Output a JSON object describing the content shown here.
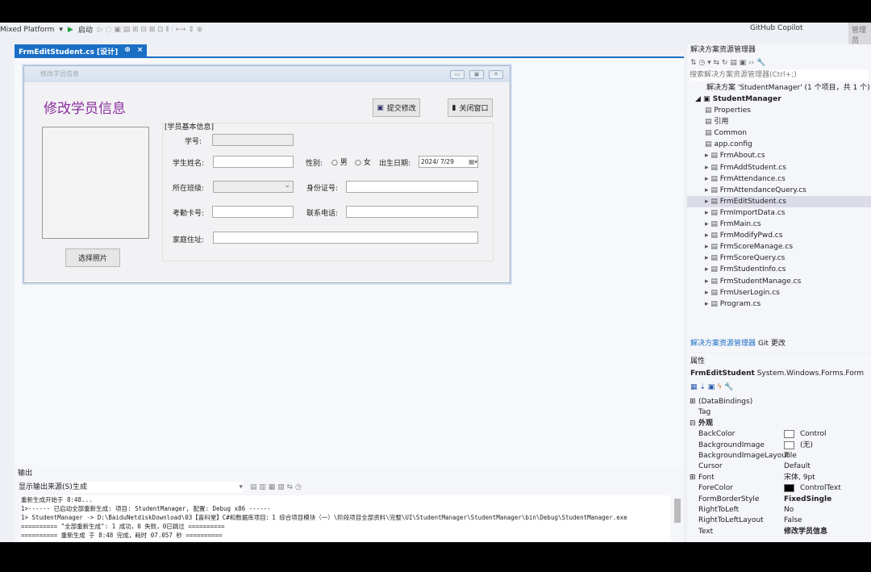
{
  "toolbar": {
    "platform": "Mixed Platform",
    "start": "启动",
    "copilot": "GitHub Copilot",
    "manage": "管理员"
  },
  "doc_tab": {
    "label": "FrmEditStudent.cs [设计]",
    "pin": "⊕",
    "close": "×"
  },
  "form": {
    "window_title": "修改学员信息",
    "heading": "修改学员信息",
    "submit": "提交修改",
    "close_window": "关闭窗口",
    "choose_photo": "选择照片",
    "group_title": "[学员基本信息]",
    "fields": {
      "student_id": "学号:",
      "name": "学生姓名:",
      "gender": "性别:",
      "male": "男",
      "female": "女",
      "birth": "出生日期:",
      "birth_value": "2024/ 7/29",
      "class": "所在班级:",
      "id_card": "身份证号:",
      "card_no": "考勤卡号:",
      "phone": "联系电话:",
      "address": "家庭住址:"
    }
  },
  "solution_explorer": {
    "title": "解决方案资源管理器",
    "search_placeholder": "搜索解决方案资源管理器(Ctrl+;)",
    "solution": "解决方案 'StudentManager' (1 个项目，共 1 个)",
    "project": "StudentManager",
    "items": [
      "Properties",
      "引用",
      "Common",
      "app.config",
      "FrmAbout.cs",
      "FrmAddStudent.cs",
      "FrmAttendance.cs",
      "FrmAttendanceQuery.cs",
      "FrmEditStudent.cs",
      "FrmImportData.cs",
      "FrmMain.cs",
      "FrmModifyPwd.cs",
      "FrmScoreManage.cs",
      "FrmScoreQuery.cs",
      "FrmStudentInfo.cs",
      "FrmStudentManage.cs",
      "FrmUserLogin.cs",
      "Program.cs"
    ],
    "selected": "FrmEditStudent.cs",
    "tabs": [
      "解决方案资源管理器",
      "Git 更改"
    ]
  },
  "properties": {
    "title": "属性",
    "object": "FrmEditStudent",
    "type": "System.Windows.Forms.Form",
    "rows": [
      [
        "(DataBindings)",
        ""
      ],
      [
        "Tag",
        ""
      ],
      [
        "外观",
        ""
      ],
      [
        "BackColor",
        "Control"
      ],
      [
        "BackgroundImage",
        "(无)"
      ],
      [
        "BackgroundImageLayout",
        "Tile"
      ],
      [
        "Cursor",
        "Default"
      ],
      [
        "Font",
        "宋体, 9pt"
      ],
      [
        "ForeColor",
        "ControlText"
      ],
      [
        "FormBorderStyle",
        "FixedSingle"
      ],
      [
        "RightToLeft",
        "No"
      ],
      [
        "RightToLeftLayout",
        "False"
      ],
      [
        "Text",
        "修改学员信息"
      ]
    ]
  },
  "output": {
    "title": "输出",
    "source_label": "显示输出来源(S):",
    "source_value": "生成",
    "lines": [
      "重新生成开始于 8:48...",
      "1>------ 已启动全部重新生成: 项目: StudentManager, 配置: Debug x86 ------",
      "1>  StudentManager -> D:\\BaiduNetdiskDownload\\03【喜科堂】C#和数据库项目：1 综合项目模块（一）\\阶段项目全部资料\\完整\\UI\\StudentManager\\StudentManager\\bin\\Debug\\StudentManager.exe",
      "========== \"全部重新生成\": 1 成功，0 失败，0已跳过 ==========",
      "========== 重新生成 于 8:48 完成，耗时 07.057 秒 =========="
    ]
  }
}
